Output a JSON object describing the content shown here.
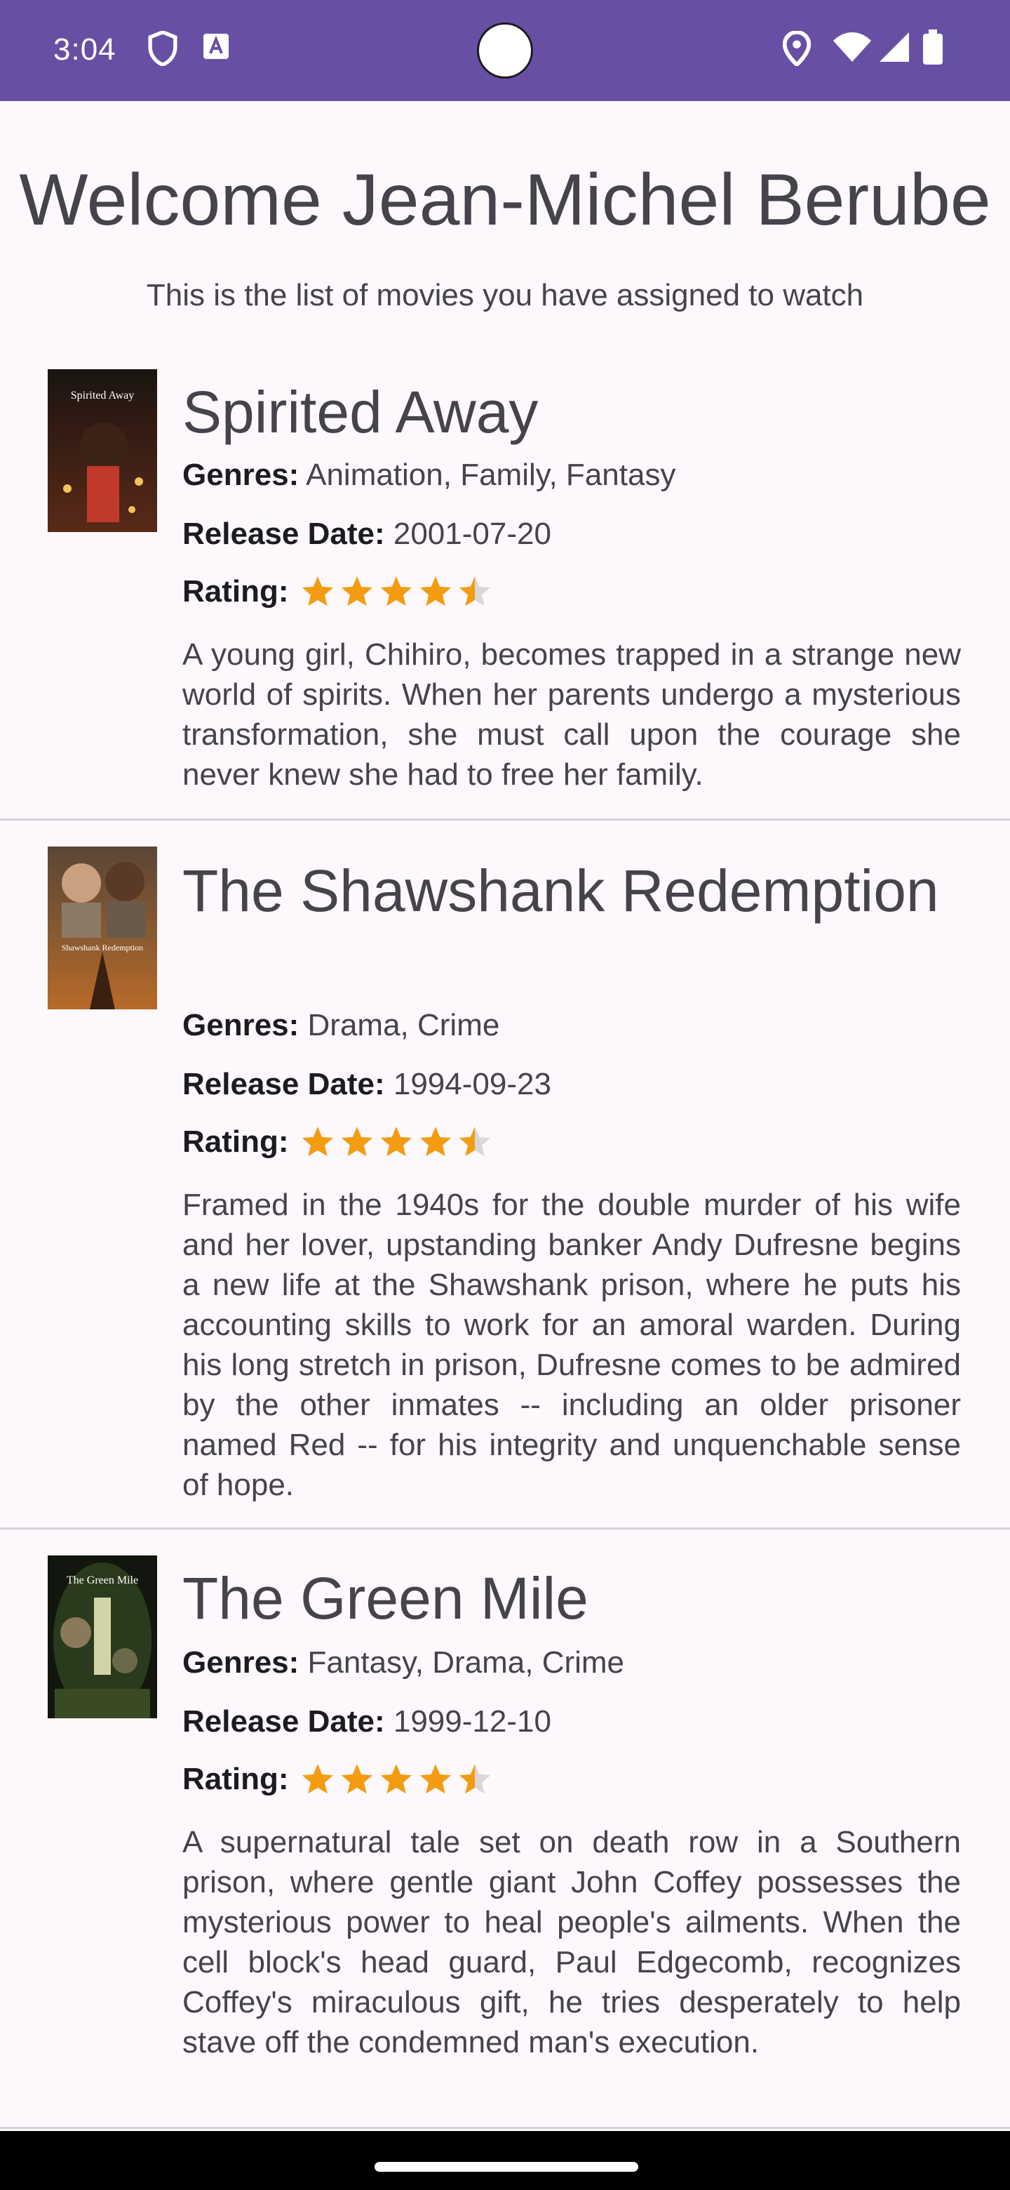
{
  "status_bar": {
    "time": "3:04",
    "icons": [
      "shield-icon",
      "font-download-icon",
      "location-icon",
      "wifi-icon",
      "cellular-icon",
      "battery-icon"
    ],
    "background": "#6750a4"
  },
  "header": {
    "title": "Welcome Jean-Michel Berube",
    "subtitle": "This is the list of movies you have assigned to watch"
  },
  "labels": {
    "genres": "Genres:",
    "release_date": "Release Date:",
    "rating": "Rating:"
  },
  "movies": [
    {
      "title": "Spirited Away",
      "poster_text": "Spirited Away",
      "genres": "Animation, Family, Fantasy",
      "release_date": "2001-07-20",
      "rating_stars": 4.5,
      "overview": "A young girl, Chihiro, becomes trapped in a strange new world of spirits. When her parents undergo a mysterious transformation, she must call upon the courage she never knew she had to free her family."
    },
    {
      "title": "The Shawshank Redemption",
      "poster_text": "Shawshank Redemption",
      "genres": "Drama, Crime",
      "release_date": "1994-09-23",
      "rating_stars": 4.5,
      "overview": "Framed in the 1940s for the double murder of his wife and her lover, upstanding banker Andy Dufresne begins a new life at the Shawshank prison, where he puts his accounting skills to work for an amoral warden. During his long stretch in prison, Dufresne comes to be admired by the other inmates -- including an older prisoner named Red -- for his integrity and unquenchable sense of hope."
    },
    {
      "title": "The Green Mile",
      "poster_text": "The Green Mile",
      "genres": "Fantasy, Drama, Crime",
      "release_date": "1999-12-10",
      "rating_stars": 4.5,
      "overview": "A supernatural tale set on death row in a Southern prison, where gentle giant John Coffey possesses the mysterious power to heal people's ailments. When the cell block's head guard, Paul Edgecomb, recognizes Coffey's miraculous gift, he tries desperately to help stave off the condemned man's execution."
    }
  ],
  "colors": {
    "star_filled": "#f39c12",
    "star_empty": "#d8d8d8",
    "accent": "#6750a4"
  }
}
